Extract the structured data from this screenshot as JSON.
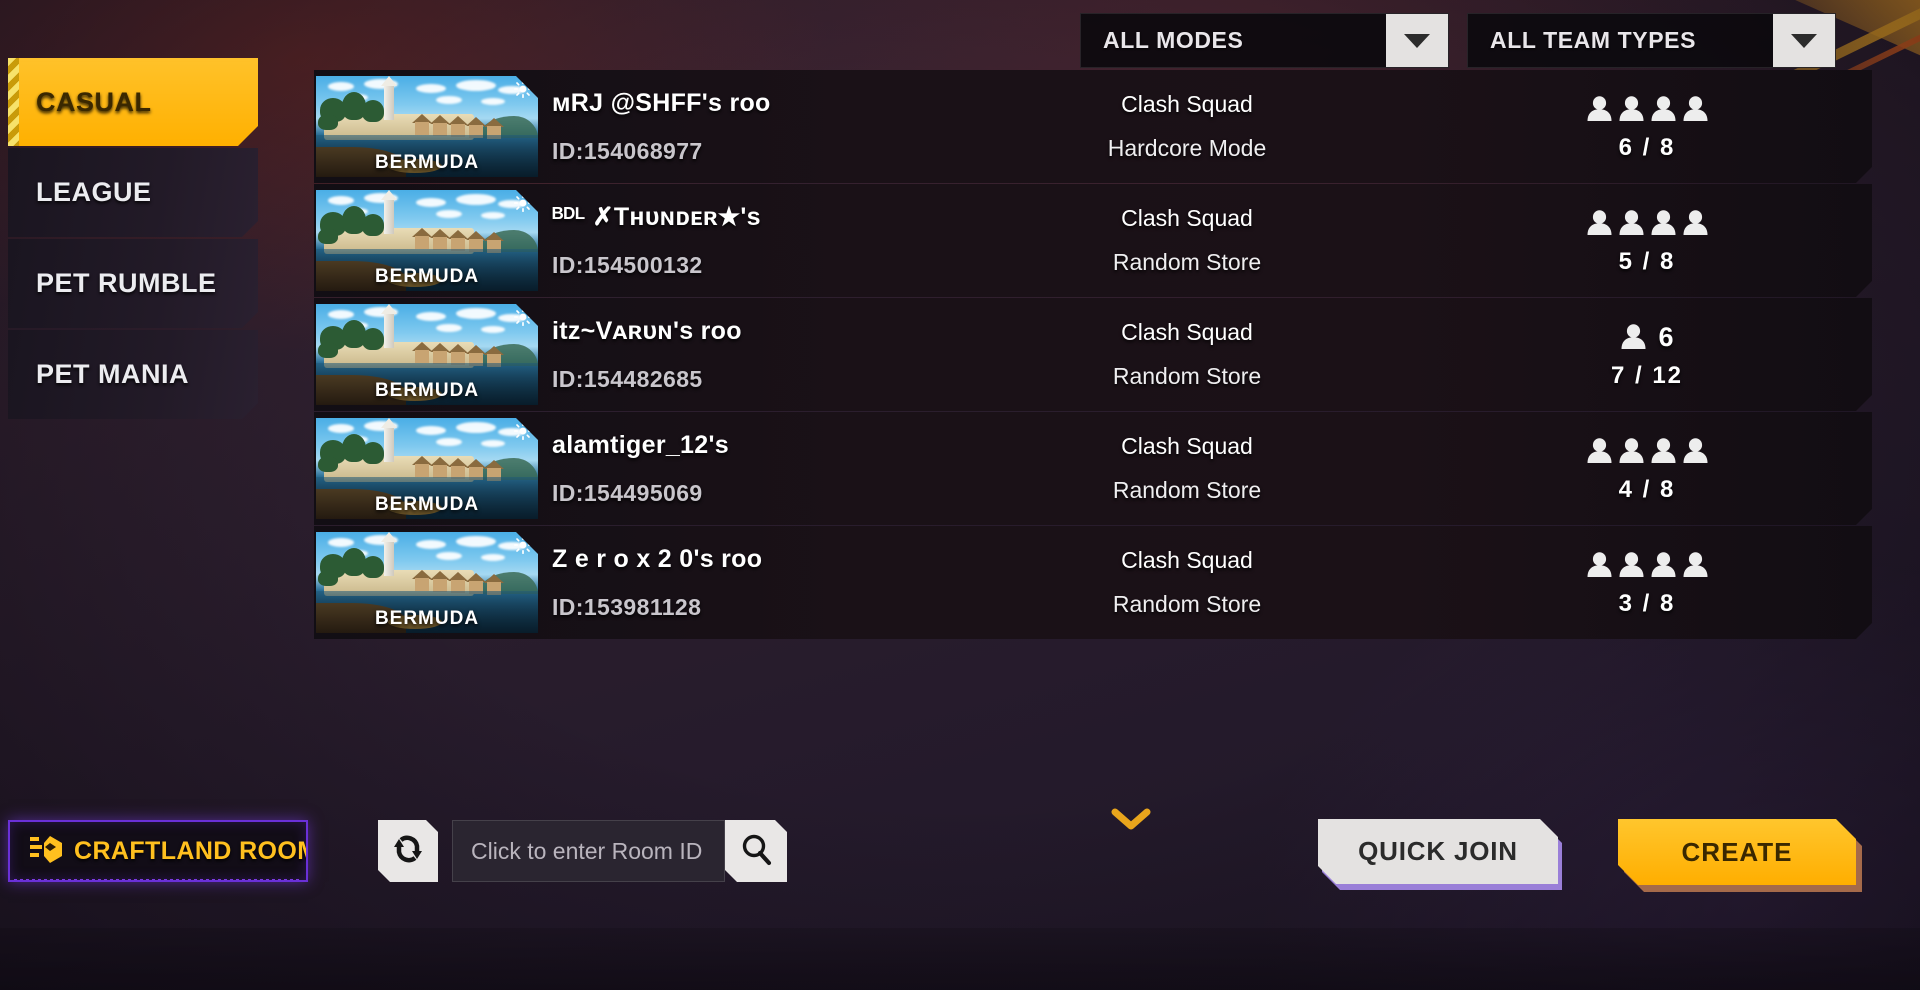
{
  "filters": [
    {
      "name": "all-modes",
      "label": "ALL MODES",
      "icon": "chevron-down-icon"
    },
    {
      "name": "all-team-types",
      "label": "ALL TEAM TYPES",
      "icon": "chevron-down-icon"
    }
  ],
  "tabs": [
    {
      "label": "CASUAL",
      "active": true
    },
    {
      "label": "LEAGUE",
      "active": false
    },
    {
      "label": "PET RUMBLE",
      "active": false
    },
    {
      "label": "PET MANIA",
      "active": false
    }
  ],
  "rooms": [
    {
      "map": "BERMUDA",
      "name": "ᴍRJ @SHFF's roo",
      "id": "ID:154068977",
      "mode": "Clash Squad",
      "submode": "Hardcore Mode",
      "team_icons": 4,
      "extra_count": "",
      "slots": "6 / 8"
    },
    {
      "map": "BERMUDA",
      "name": "ᴮᴰᴸ ✗Tʜᴜɴᴅᴇʀ★'s",
      "id": "ID:154500132",
      "mode": "Clash Squad",
      "submode": "Random Store",
      "team_icons": 4,
      "extra_count": "",
      "slots": "5 / 8"
    },
    {
      "map": "BERMUDA",
      "name": "itz~Vᴀʀᴜɴ's roo",
      "id": "ID:154482685",
      "mode": "Clash Squad",
      "submode": "Random Store",
      "team_icons": 1,
      "extra_count": "6",
      "slots": "7 / 12"
    },
    {
      "map": "BERMUDA",
      "name": "alamtiger_12's",
      "id": "ID:154495069",
      "mode": "Clash Squad",
      "submode": "Random Store",
      "team_icons": 4,
      "extra_count": "",
      "slots": "4 / 8"
    },
    {
      "map": "BERMUDA",
      "name": "Z e r o x     2 0's roo",
      "id": "ID:153981128",
      "mode": "Clash Squad",
      "submode": "Random Store",
      "team_icons": 4,
      "extra_count": "",
      "slots": "3 / 8"
    }
  ],
  "bottom": {
    "craftland_label": "CRAFTLAND ROOMS",
    "craftland_icon": "craftland-cube-icon",
    "refresh_icon": "refresh-icon",
    "search_placeholder": "Click to enter Room ID",
    "search_value": "",
    "search_icon": "search-icon",
    "expand_icon": "chevron-down-icon",
    "quick_join_label": "QUICK JOIN",
    "create_label": "CREATE"
  },
  "colors": {
    "accent_yellow": "#ffb91f",
    "craftland_purple": "#6a30d8",
    "panel_dark": "#14101a",
    "text_light": "#ffffff"
  }
}
